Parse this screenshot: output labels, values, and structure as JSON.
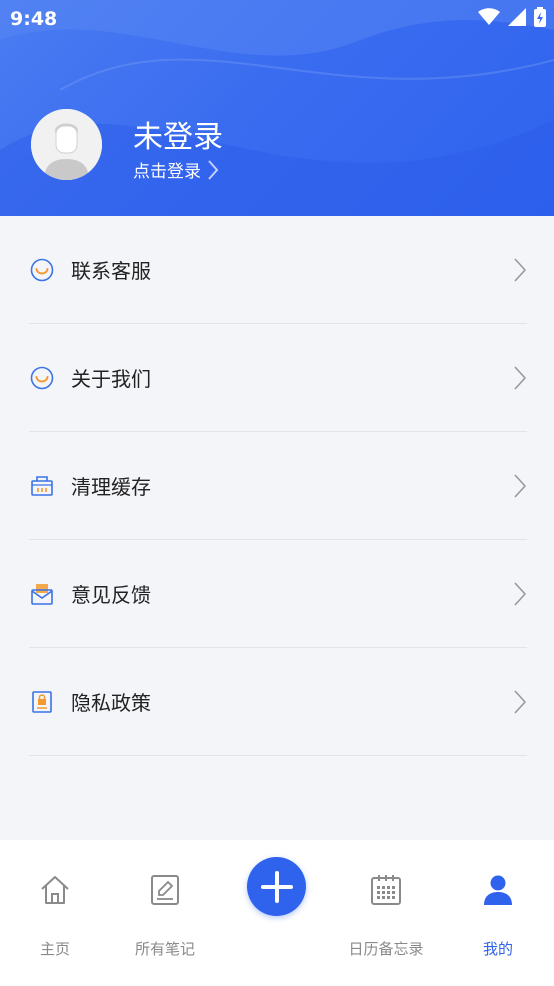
{
  "status_bar": {
    "time": "9:48"
  },
  "profile": {
    "name": "未登录",
    "login_prompt": "点击登录"
  },
  "menu": [
    {
      "label": "联系客服",
      "icon": "headset-smile-icon"
    },
    {
      "label": "关于我们",
      "icon": "smile-circle-icon"
    },
    {
      "label": "清理缓存",
      "icon": "basket-icon"
    },
    {
      "label": "意见反馈",
      "icon": "mail-icon"
    },
    {
      "label": "隐私政策",
      "icon": "lock-document-icon"
    }
  ],
  "tabbar": {
    "items": [
      {
        "label": "主页",
        "icon": "home-icon"
      },
      {
        "label": "所有笔记",
        "icon": "note-edit-icon"
      },
      {
        "label": "日历备忘录",
        "icon": "calendar-icon"
      },
      {
        "label": "我的",
        "icon": "person-icon"
      }
    ],
    "add_icon": "plus-icon"
  },
  "colors": {
    "brand": "#2f63ee",
    "orange_accent": "#f29a2e",
    "inactive_tab": "#8a8a8a"
  }
}
